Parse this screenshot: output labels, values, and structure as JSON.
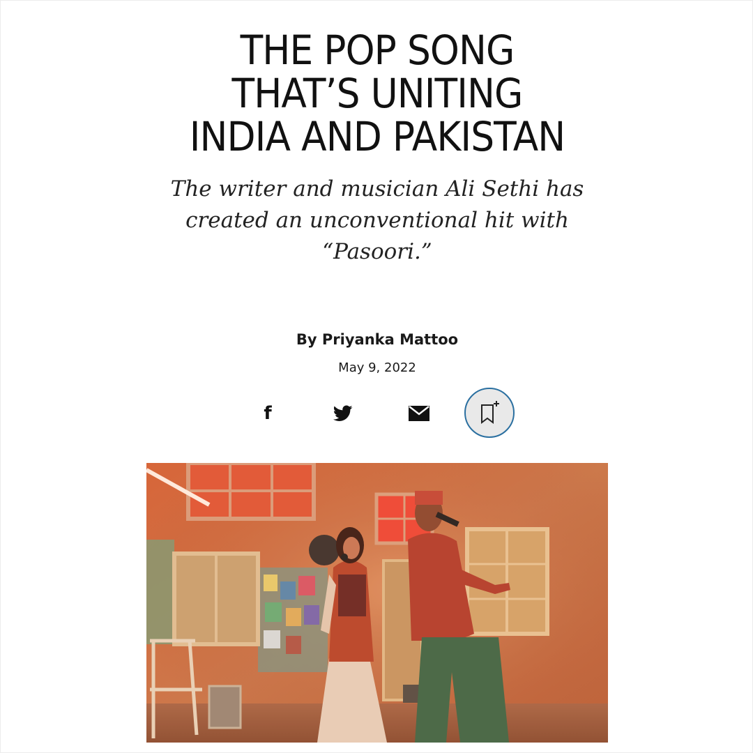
{
  "article": {
    "headline_lines": [
      "THE POP SONG",
      "THAT’S UNITING",
      "INDIA AND PAKISTAN"
    ],
    "dek": "The writer and musician Ali Sethi has created an unconventional hit with “Pasoori.”",
    "byline": "By Priyanka Mattoo",
    "date": "May 9, 2022"
  },
  "share": {
    "items": [
      {
        "name": "facebook",
        "icon": "facebook-icon"
      },
      {
        "name": "twitter",
        "icon": "twitter-icon"
      },
      {
        "name": "email",
        "icon": "mail-icon"
      },
      {
        "name": "save",
        "icon": "bookmark-add-icon"
      }
    ]
  },
  "colors": {
    "text": "#111111",
    "save_ring": "#2a6fa0",
    "save_fill": "#e9e9e9"
  }
}
